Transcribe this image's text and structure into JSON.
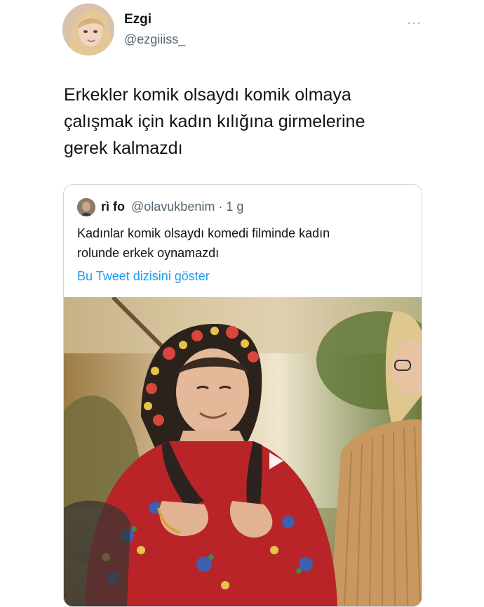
{
  "author": {
    "name": "Ezgi",
    "handle": "@ezgiiiss_"
  },
  "more_icon": "···",
  "tweet": {
    "text_lines": [
      "Erkekler komik olsaydı komik olmaya",
      "çalışmak için kadın kılığına girmelerine",
      "gerek kalmazdı"
    ]
  },
  "quote": {
    "name": "rì fo",
    "handle": "@olavukbenim · 1 g",
    "text_lines": [
      "Kadınlar komik olsaydı komedi filminde kadın",
      "rolunde erkek oynamazdı"
    ],
    "thread_link": "Bu Tweet dizisini göster"
  },
  "media": {
    "type": "video",
    "icon": "play-icon"
  },
  "colors": {
    "link": "#1d9bf0",
    "secondary_text": "#536471",
    "border": "#cfd9de"
  }
}
